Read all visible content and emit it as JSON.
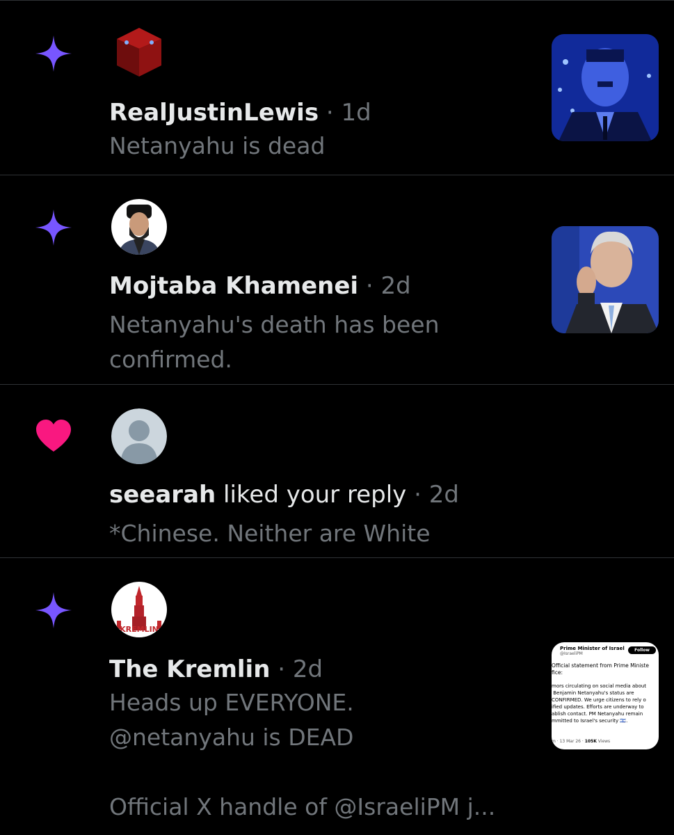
{
  "notifications": [
    {
      "type": "post",
      "type_icon": "sparkle-icon",
      "avatar": "red-cube-avatar",
      "name": "RealJustinLewis",
      "time": "· 1d",
      "body": "Netanyahu is dead",
      "thumbnail": "blue-portrait-thumbnail"
    },
    {
      "type": "post",
      "type_icon": "sparkle-icon",
      "avatar": "cleric-avatar",
      "name": "Mojtaba Khamenei",
      "time": "· 2d",
      "body": "Netanyahu's death has been confirmed.",
      "thumbnail": "netanyahu-photo-thumbnail"
    },
    {
      "type": "like",
      "type_icon": "heart-icon",
      "avatar": "default-avatar",
      "name": "seearah",
      "action": " liked your reply",
      "time": " · 2d",
      "body": "*Chinese. Neither are White"
    },
    {
      "type": "post",
      "type_icon": "sparkle-icon",
      "avatar": "kremlin-avatar",
      "avatar_text": "KREMLIN",
      "name": "The Kremlin",
      "time": "· 2d",
      "body": "Heads up EVERYONE.\n@netanyahu is DEAD\n\nOfficial X handle of @IsraeliPM j...",
      "thumbnail": "tweet-screenshot-thumbnail",
      "thumbnail_content": {
        "account": "Prime Minister of Israel",
        "handle": "@IsraeliPM",
        "follow": "Follow",
        "line1": "Official statement from Prime Ministe",
        "line2": "fice:",
        "text": "mors circulating on social media about\n Benjamin Netanyahu's status are\nCONFIRMED. We urge citizens to rely o\nified updates. Efforts are underway to\nablish contact. PM Netanyahu remain\nmmitted to Israel's security 🇮🇱.",
        "footer_time": "m · 13 Mar 26 · ",
        "footer_views": "105K",
        "footer_views_label": " Views"
      }
    }
  ],
  "colors": {
    "sparkle": "#7856ff",
    "heart": "#f91880",
    "divider": "#2f3336",
    "muted": "#71767b",
    "text": "#e7e9ea"
  }
}
